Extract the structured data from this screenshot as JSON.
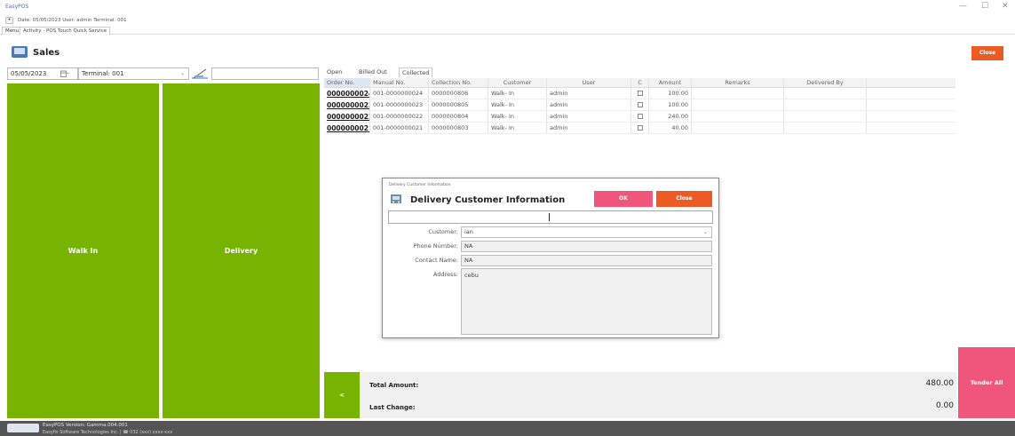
{
  "titlebar": {
    "app_name": "EasyPOS",
    "minimize": "—",
    "maximize": "☐",
    "close": "✕"
  },
  "infobar": {
    "text": "Date: 05/05/2023   User: admin   Terminal: 001",
    "pill": "•"
  },
  "menu": {
    "tabs": [
      "Menu",
      "Activity - POS Touch Quick Service"
    ]
  },
  "header": {
    "title": "Sales",
    "close_label": "Close"
  },
  "filters": {
    "date": "05/05/2023",
    "terminal": "Terminal: 001",
    "search_value": ""
  },
  "buttons": {
    "walk_in": "Walk In",
    "delivery": "Delivery",
    "tender_all": "Tender All",
    "small_green": "<"
  },
  "tabs": [
    "Open",
    "Billed Out",
    "Collected"
  ],
  "table": {
    "headers": [
      "Order No.",
      "Manual No.",
      "Collection No.",
      "Customer",
      "User",
      "C",
      "Amount",
      "Remarks",
      "Delivered By"
    ],
    "rows": [
      {
        "order": "0000000024",
        "manual": "001-0000000024",
        "collection": "0000000806",
        "customer": "Walk- In",
        "user": "admin",
        "amount": "100.00",
        "remarks": "",
        "delivered_by": ""
      },
      {
        "order": "0000000023",
        "manual": "001-0000000023",
        "collection": "0000000805",
        "customer": "Walk- In",
        "user": "admin",
        "amount": "100.00",
        "remarks": "",
        "delivered_by": ""
      },
      {
        "order": "0000000022",
        "manual": "001-0000000022",
        "collection": "0000000804",
        "customer": "Walk- In",
        "user": "admin",
        "amount": "240.00",
        "remarks": "",
        "delivered_by": ""
      },
      {
        "order": "0000000021",
        "manual": "001-0000000021",
        "collection": "0000000803",
        "customer": "Walk- In",
        "user": "admin",
        "amount": "40.00",
        "remarks": "",
        "delivered_by": ""
      }
    ]
  },
  "dialog": {
    "window_title": "Delivery Customer Information",
    "title": "Delivery Customer Information",
    "ok_label": "OK",
    "close_label": "Close",
    "search_value": "",
    "customer_label": "Customer:",
    "customer_value": "ian",
    "phone_label": "Phone Number:",
    "phone_value": "NA",
    "contact_label": "Contact Name:",
    "contact_value": "NA",
    "address_label": "Address:",
    "address_value": "cebu"
  },
  "totals": {
    "total_label": "Total Amount:",
    "total_value": "480.00",
    "change_label": "Last Change:",
    "change_value": "0.00"
  },
  "footer": {
    "version": "EasyPOS Version: Gamma.004.001",
    "company": "Easyfis Software Technologies Inc. | ☎ 032 (xxx) xxxx-xxx"
  },
  "colors": {
    "green": "#77b300",
    "orange": "#ee5a24",
    "pink": "#f0567b",
    "footer": "#555555"
  }
}
